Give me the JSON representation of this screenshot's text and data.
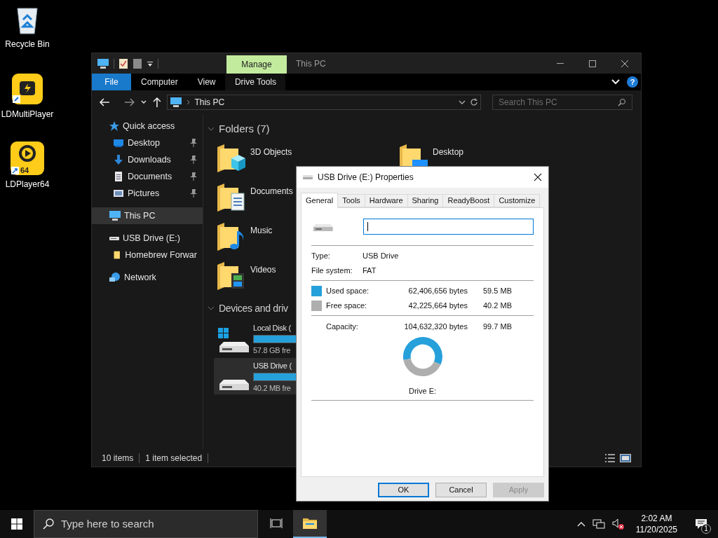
{
  "desktop_icons": [
    {
      "label": "Recycle Bin",
      "kind": "recycle-bin"
    },
    {
      "label": "LDMultiPlayer",
      "kind": "ldmulti"
    },
    {
      "label": "LDPlayer64",
      "kind": "ldplayer",
      "badge": "64"
    }
  ],
  "explorer": {
    "context_tab": "Manage",
    "title": "This PC",
    "help": "?",
    "ribbon_tabs": [
      {
        "label": "File",
        "kind": "file"
      },
      {
        "label": "Computer",
        "kind": "tab"
      },
      {
        "label": "View",
        "kind": "tab"
      },
      {
        "label": "Drive Tools",
        "kind": "context"
      }
    ],
    "address": "This PC",
    "search": {
      "placeholder": "Search This PC"
    },
    "nav": [
      {
        "label": "Quick access",
        "kind": "star",
        "selected": false,
        "children": [
          {
            "label": "Desktop",
            "kind": "desktop",
            "pinned": true,
            "selected": false
          },
          {
            "label": "Downloads",
            "kind": "downloads",
            "pinned": true,
            "selected": false
          },
          {
            "label": "Documents",
            "kind": "documents",
            "pinned": true,
            "selected": false
          },
          {
            "label": "Pictures",
            "kind": "pictures",
            "pinned": true,
            "selected": false
          }
        ]
      },
      {
        "label": "This PC",
        "kind": "pc",
        "selected": true
      },
      {
        "label": "USB Drive (E:)",
        "kind": "usb",
        "selected": false,
        "children": [
          {
            "label": "Homebrew Forwar",
            "kind": "folder",
            "selected": false
          }
        ]
      },
      {
        "label": "Network",
        "kind": "network",
        "selected": false
      }
    ],
    "folders": {
      "title": "Folders (7)",
      "expanded": true,
      "rows": [
        [
          {
            "label": "3D Objects",
            "kind": "objects"
          },
          {
            "label": "Desktop",
            "kind": "desktop"
          }
        ],
        [
          {
            "label": "Documents",
            "kind": "documents"
          }
        ],
        [
          {
            "label": "Music",
            "kind": "music"
          }
        ],
        [
          {
            "label": "Videos",
            "kind": "videos"
          }
        ]
      ]
    },
    "devices": {
      "title": "Devices and driv",
      "expanded": true,
      "items": [
        {
          "label": "Local Disk (",
          "free": "57.8 GB fre",
          "level": 0.75,
          "kind": "system",
          "selected": false
        },
        {
          "label": "USB Drive (",
          "free": "40.2 MB fre",
          "level": 0.6,
          "kind": "usb",
          "selected": true
        }
      ]
    },
    "status": {
      "count": "10 items",
      "selection": "1 item selected"
    }
  },
  "dialog": {
    "title": "USB Drive (E:) Properties",
    "tabs": [
      {
        "label": "General",
        "selected": true
      },
      {
        "label": "Tools",
        "selected": false
      },
      {
        "label": "Hardware",
        "selected": false
      },
      {
        "label": "Sharing",
        "selected": false
      },
      {
        "label": "ReadyBoost",
        "selected": false
      },
      {
        "label": "Customize",
        "selected": false
      }
    ],
    "name_field": {
      "focused": true
    },
    "info": [
      {
        "label": "Type:",
        "value": "USB Drive"
      },
      {
        "label": "File system:",
        "value": "FAT"
      }
    ],
    "usage": [
      {
        "label": "Used space:",
        "bytes": "62,406,656 bytes",
        "size": "59.5 MB",
        "color": "#26a0da"
      },
      {
        "label": "Free space:",
        "bytes": "42,225,664 bytes",
        "size": "40.2 MB",
        "color": "#aeaeae"
      }
    ],
    "capacity": {
      "label": "Capacity:",
      "bytes": "104,632,320 bytes",
      "size": "99.7 MB"
    },
    "chart_data": {
      "type": "donut",
      "values": [
        59.6,
        40.4
      ]
    },
    "drive_label": "Drive E:",
    "buttons": [
      {
        "label": "OK",
        "default": true,
        "disabled": false
      },
      {
        "label": "Cancel",
        "default": false,
        "disabled": false
      },
      {
        "label": "Apply",
        "default": false,
        "disabled": true
      }
    ]
  },
  "taskbar": {
    "search_placeholder": "Type here to search",
    "apps": [
      {
        "kind": "task-view",
        "active": false
      },
      {
        "kind": "explorer",
        "active": true
      }
    ],
    "time": "2:02 AM",
    "date": "11/20/2025",
    "notifications": "1"
  }
}
